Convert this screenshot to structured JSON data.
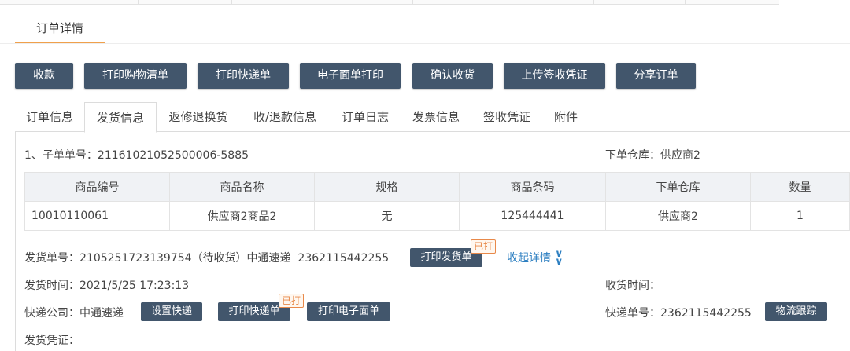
{
  "page_tab": "订单详情",
  "actions": [
    "收款",
    "打印购物清单",
    "打印快递单",
    "电子面单打印",
    "确认收货",
    "上传签收凭证",
    "分享订单"
  ],
  "tabs": [
    "订单信息",
    "发货信息",
    "返修退换货",
    "收/退款信息",
    "订单日志",
    "发票信息",
    "签收凭证",
    "附件"
  ],
  "active_tab": "发货信息",
  "sub_order": {
    "label": "1、子单单号：",
    "number": "21161021052500006-5885",
    "warehouse_label": "下单仓库：",
    "warehouse": "供应商2"
  },
  "goods_table": {
    "headers": [
      "商品编号",
      "商品名称",
      "规格",
      "商品条码",
      "下单仓库",
      "数量"
    ],
    "rows": [
      [
        "10010110061",
        "供应商2商品2",
        "无",
        "125444441",
        "供应商2",
        "1"
      ]
    ]
  },
  "shipment": {
    "number_label": "发货单号：",
    "number": "2105251723139754",
    "status": "（待收货）",
    "carrier_inline": "中通速递",
    "tracking_inline": "2362115442255",
    "print_ship_button": "打印发货单",
    "printed_badge": "已打",
    "collapse_link": "收起详情",
    "collapse_icon": "double-chevron-down-icon",
    "ship_time_label": "发货时间：",
    "ship_time": "2021/5/25 17:23:13",
    "receive_time_label": "收货时间：",
    "receive_time": "",
    "courier_label": "快递公司：",
    "courier": "中通速递",
    "set_courier_button": "设置快递",
    "print_express_button": "打印快递单",
    "print_express_badge": "已打",
    "print_e_button": "打印电子面单",
    "tracking_label": "快递单号：",
    "tracking": "2362115442255",
    "logistics_button": "物流跟踪",
    "voucher_label": "发货凭证："
  },
  "colors": {
    "button_dark": "#42566c",
    "tab_accent": "#f0a04b",
    "badge": "#e8894a",
    "link": "#2d7fc1"
  }
}
